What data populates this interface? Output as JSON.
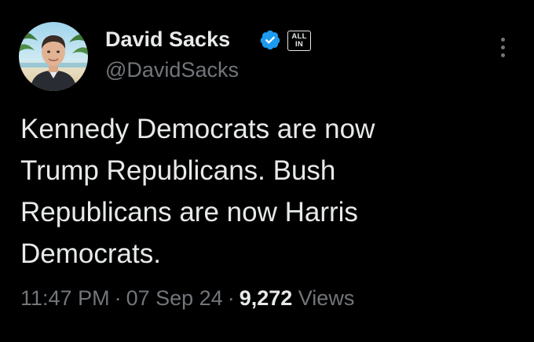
{
  "tweet": {
    "author": {
      "display_name": "David Sacks",
      "handle": "@DavidSacks",
      "verified": true,
      "verified_color": "#1d9bf0",
      "affiliation_badge": [
        "ALL",
        "IN"
      ],
      "avatar_icon": "profile-photo"
    },
    "text": "Kennedy Democrats are now\nTrump Republicans. Bush\nRepublicans are now Harris\nDemocrats.",
    "time": "11:47 PM",
    "date": "07 Sep 24",
    "separator": "·",
    "views_count": "9,272",
    "views_label": "Views",
    "more_icon": "more-vertical-icon"
  },
  "theme": {
    "background": "#000000",
    "text_primary": "#e7e9ea",
    "text_secondary": "#71767b",
    "accent": "#1d9bf0"
  }
}
